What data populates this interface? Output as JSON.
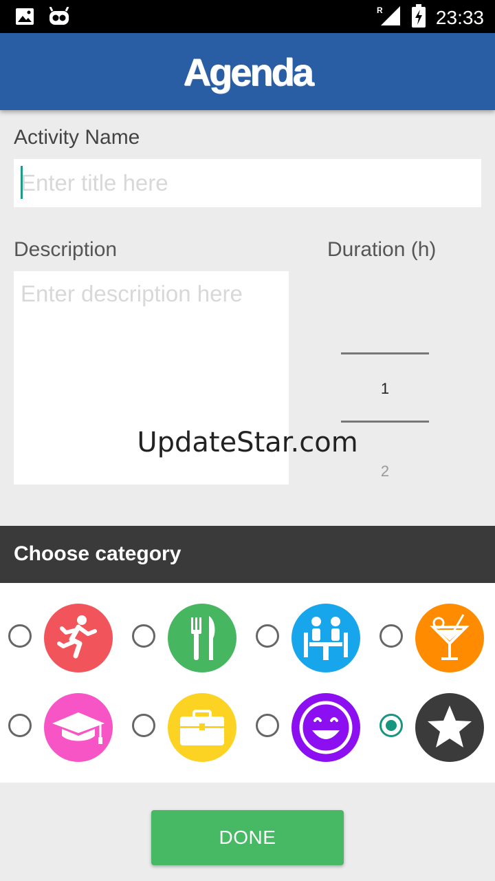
{
  "status_bar": {
    "time": "23:33",
    "icons": [
      "image-icon",
      "cyanogen-mascot-icon",
      "signal-roaming-icon",
      "battery-charging-icon"
    ],
    "roaming_indicator": "R"
  },
  "app_bar": {
    "title": "Agenda",
    "color": "#295ea4"
  },
  "form": {
    "activity_label": "Activity Name",
    "title_placeholder": "Enter title here",
    "description_label": "Description",
    "description_placeholder": "Enter description here",
    "duration_label": "Duration (h)",
    "duration_selected": "1",
    "duration_next": "2"
  },
  "watermark": "UpdateStar.com",
  "category": {
    "header": "Choose category",
    "selected_index": 7,
    "items": [
      {
        "icon": "running-person-icon",
        "color": "#f2545b",
        "checked": false
      },
      {
        "icon": "fork-knife-icon",
        "color": "#46b660",
        "checked": false
      },
      {
        "icon": "meeting-icon",
        "color": "#17a6ec",
        "checked": false
      },
      {
        "icon": "cocktail-icon",
        "color": "#ff8c00",
        "checked": false
      },
      {
        "icon": "graduation-cap-icon",
        "color": "#f754c6",
        "checked": false
      },
      {
        "icon": "briefcase-icon",
        "color": "#fcd223",
        "checked": false
      },
      {
        "icon": "smiley-icon",
        "color": "#8b0ff0",
        "checked": false
      },
      {
        "icon": "star-icon",
        "color": "#3b3b3b",
        "checked": true
      }
    ]
  },
  "done_button": {
    "label": "DONE",
    "color": "#47b965"
  },
  "colors": {
    "accent": "#16967f",
    "category_header_bg": "#3a3a3a"
  }
}
